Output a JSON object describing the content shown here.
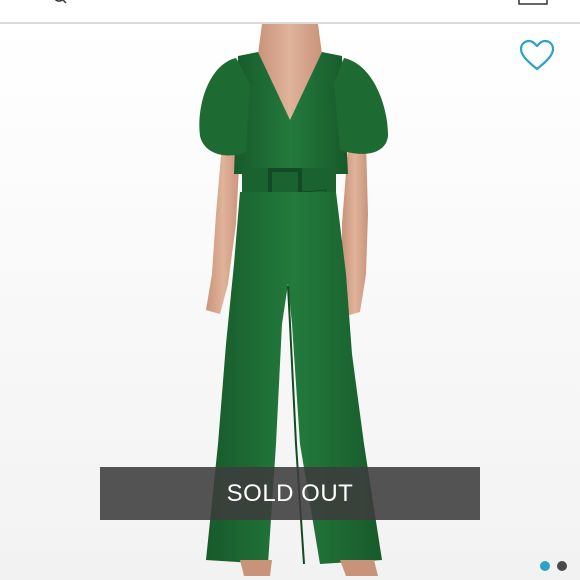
{
  "top_bar": {
    "search_icon": "search-icon",
    "bag_icon": "shopping-bag-icon"
  },
  "wishlist": {
    "icon": "heart-outline-icon",
    "color": "#2aa3c4"
  },
  "product_image": {
    "subject": "green-puff-sleeve-belted-jumpsuit",
    "garment_color": "#1f6e36"
  },
  "status_overlay": {
    "label": "SOLD OUT"
  },
  "carousel": {
    "total": 2,
    "active_index": 0,
    "active_color": "#2aa3c4",
    "inactive_color": "#4a4a4a"
  }
}
